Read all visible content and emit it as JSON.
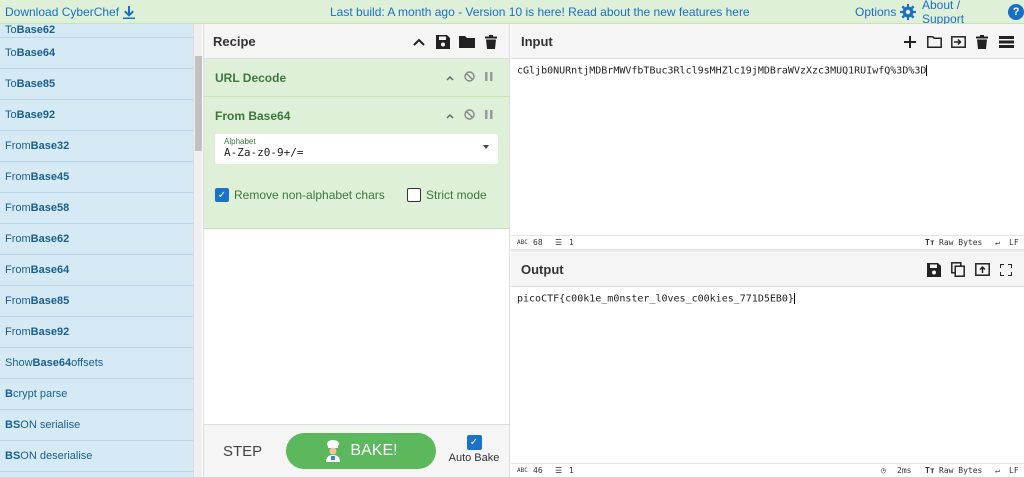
{
  "banner": {
    "download": "Download CyberChef",
    "message": "Last build: A month ago - Version 10 is here! Read about the new features here",
    "options": "Options",
    "about": "About / Support"
  },
  "operations": [
    {
      "pre": "To ",
      "bold": "Base62",
      "post": ""
    },
    {
      "pre": "To ",
      "bold": "Base64",
      "post": ""
    },
    {
      "pre": "To ",
      "bold": "Base85",
      "post": ""
    },
    {
      "pre": "To ",
      "bold": "Base92",
      "post": ""
    },
    {
      "pre": "From ",
      "bold": "Base32",
      "post": ""
    },
    {
      "pre": "From ",
      "bold": "Base45",
      "post": ""
    },
    {
      "pre": "From ",
      "bold": "Base58",
      "post": ""
    },
    {
      "pre": "From ",
      "bold": "Base62",
      "post": ""
    },
    {
      "pre": "From ",
      "bold": "Base64",
      "post": ""
    },
    {
      "pre": "From ",
      "bold": "Base85",
      "post": ""
    },
    {
      "pre": "From ",
      "bold": "Base92",
      "post": ""
    },
    {
      "pre": "Show ",
      "bold": "Base64",
      "post": " offsets"
    },
    {
      "pre": "",
      "bold": "B",
      "post": "crypt parse"
    },
    {
      "pre": "",
      "bold": "BS",
      "post": "ON serialise"
    },
    {
      "pre": "",
      "bold": "BS",
      "post": "ON deserialise"
    }
  ],
  "recipe": {
    "title": "Recipe",
    "op1": "URL Decode",
    "op2": "From Base64",
    "alphabet_label": "Alphabet",
    "alphabet_value": "A-Za-z0-9+/=",
    "remove_label": "Remove non-alphabet chars",
    "remove_checked": true,
    "strict_label": "Strict mode",
    "strict_checked": false
  },
  "bake": {
    "step": "STEP",
    "bake": "BAKE!",
    "autobake": "Auto Bake",
    "autobake_checked": true
  },
  "input": {
    "title": "Input",
    "text": "cGljb0NURntjMDBrMWVfbTBuc3Rlcl9sMHZlc19jMDBraWVzXzc3MUQ1RUIwfQ%3D%3D",
    "length": "68",
    "lines": "1",
    "encoding": "Raw Bytes",
    "eol": "LF"
  },
  "output": {
    "title": "Output",
    "text": "picoCTF{c00k1e_m0nster_l0ves_c00kies_771D5EB0}",
    "length": "46",
    "lines": "1",
    "time": "2ms",
    "encoding": "Raw Bytes",
    "eol": "LF"
  },
  "labels": {
    "abc": "ABC",
    "tt": "Tт"
  },
  "colors": {
    "banner_bg": "#dff0d8",
    "ops_bg": "#d6eaf5",
    "op_block_bg": "#dff0d8",
    "bake_green": "#5cb85c",
    "link_blue": "#1a6fc4"
  }
}
